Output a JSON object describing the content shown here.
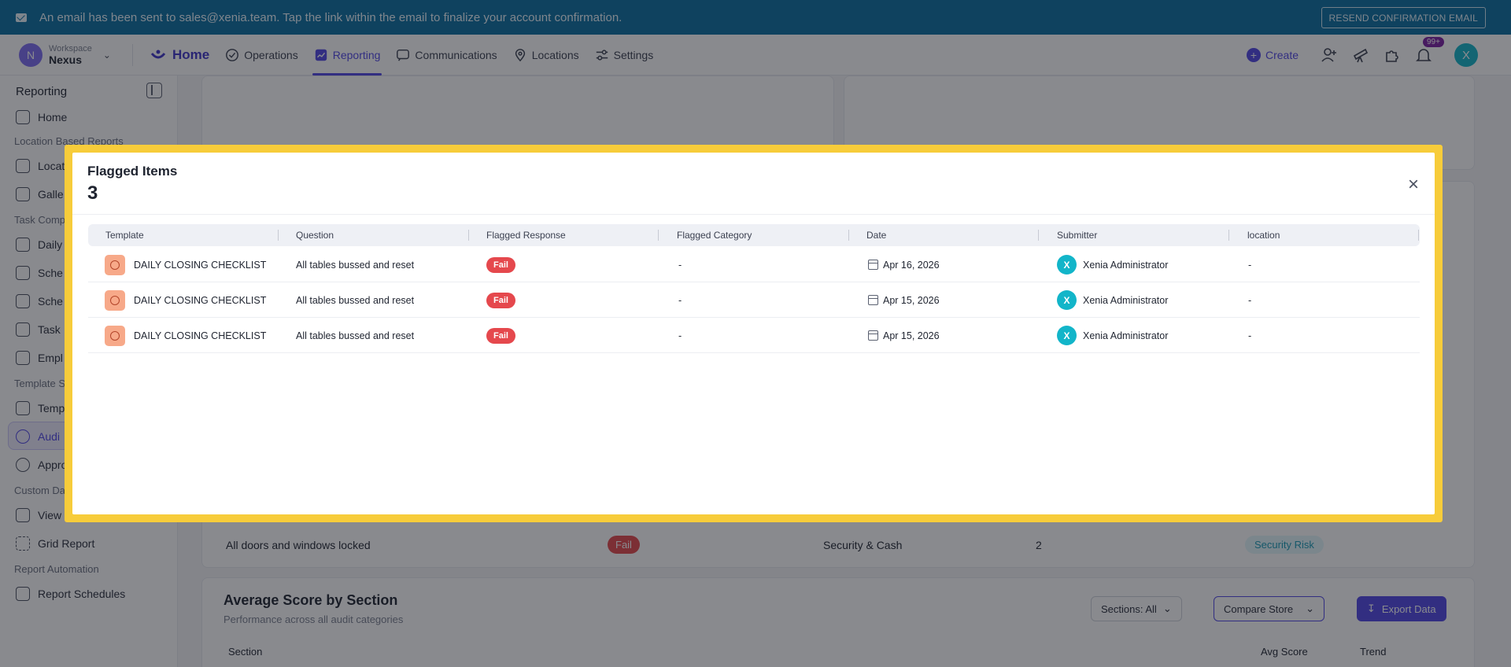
{
  "banner": {
    "message": "An email has been sent to sales@xenia.team. Tap the link within the email to finalize your account confirmation.",
    "resend_label": "RESEND CONFIRMATION EMAIL"
  },
  "workspace": {
    "label": "Workspace",
    "name": "Nexus",
    "initial": "N"
  },
  "nav": {
    "home": "Home",
    "items": [
      "Operations",
      "Reporting",
      "Communications",
      "Locations",
      "Settings"
    ],
    "active": "Reporting",
    "create": "Create",
    "notif_badge": "99+",
    "user_initial": "X"
  },
  "sidebar": {
    "title": "Reporting",
    "home": "Home",
    "sec_location": "Location Based Reports",
    "item_location": "Locat",
    "item_gallery": "Galle",
    "sec_task": "Task Comp",
    "item_daily": "Daily",
    "item_sched1": "Sche",
    "item_sched2": "Sche",
    "item_task": "Task",
    "item_emp": "Empl",
    "sec_template": "Template S",
    "item_temp": "Temp",
    "item_audit": "Audi",
    "item_approv": "Appro",
    "sec_custom": "Custom Da",
    "item_view": "View",
    "item_grid": "Grid Report",
    "sec_automation": "Report Automation",
    "item_schedules": "Report Schedules"
  },
  "background": {
    "row_question": "All doors and windows locked",
    "row_response": "Fail",
    "row_category": "Security & Cash",
    "row_count": "2",
    "row_tag": "Security Risk",
    "section_title": "Average Score by Section",
    "section_sub": "Performance across all audit categories",
    "sections_btn": "Sections: All",
    "compare_btn": "Compare Store",
    "export_btn": "Export Data",
    "col_section": "Section",
    "col_avg": "Avg Score",
    "col_trend": "Trend"
  },
  "modal": {
    "title": "Flagged Items",
    "count": "3",
    "columns": [
      "Template",
      "Question",
      "Flagged Response",
      "Flagged Category",
      "Date",
      "Submitter",
      "location"
    ],
    "rows": [
      {
        "template": "DAILY CLOSING CHECKLIST",
        "question": "All tables bussed and reset",
        "response": "Fail",
        "category": "-",
        "date": "Apr 16, 2026",
        "submitter": "Xenia Administrator",
        "submitter_initial": "X",
        "location": "-"
      },
      {
        "template": "DAILY CLOSING CHECKLIST",
        "question": "All tables bussed and reset",
        "response": "Fail",
        "category": "-",
        "date": "Apr 15, 2026",
        "submitter": "Xenia Administrator",
        "submitter_initial": "X",
        "location": "-"
      },
      {
        "template": "DAILY CLOSING CHECKLIST",
        "question": "All tables bussed and reset",
        "response": "Fail",
        "category": "-",
        "date": "Apr 15, 2026",
        "submitter": "Xenia Administrator",
        "submitter_initial": "X",
        "location": "-"
      }
    ]
  }
}
